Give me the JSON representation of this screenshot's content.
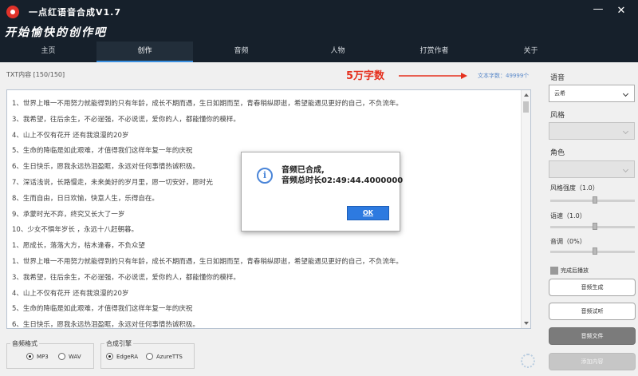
{
  "window": {
    "title": "一点红语音合成V1.7",
    "minimize": "—",
    "close": "✕"
  },
  "banner": {
    "slogan": "开始愉快的创作吧"
  },
  "tabs": [
    {
      "label": "主页"
    },
    {
      "label": "创作"
    },
    {
      "label": "音频"
    },
    {
      "label": "人物"
    },
    {
      "label": "打赏作者"
    },
    {
      "label": "关于"
    }
  ],
  "active_tab": "创作",
  "editor": {
    "header": "TXT内容 [150/150]",
    "annotation": "5万字数",
    "word_count": "文本字数：49999个",
    "lines": [
      "1、世界上唯一不用努力就能得到的只有年龄，成长不期而遇，生日如期而至，青春稍纵即逝，希望能遇见更好的自己，不负流年。",
      "3、我希望，往后余生，不必逞强，不必说谎，爱你的人，都能懂你的模样。",
      "4、山上不仅有花开 还有我浪漫的20岁",
      "5、生命的降临是如此艰难，才值得我们这样年复一年的庆祝",
      "6、生日快乐，愿我永远热泪盈眶，永远对任何事情热诚积极。",
      "7、深话浅说，长路慢走，未来美好的岁月里，愿一切安好，愿时光",
      "8、生而自由，日日欢愉，快意人生，乐得自在。",
      "9、承蒙时光不弃，终究又长大了一岁",
      "10、少女不惧年岁长 ，永远十八赶朝暮。",
      "1、愿成长，落落大方，枯木逢春，不负众望",
      "1、世界上唯一不用努力就能得到的只有年龄，成长不期而遇，生日如期而至，青春稍纵即逝，希望能遇见更好的自己，不负流年。",
      "3、我希望，往后余生，不必逞强，不必说谎，爱你的人，都能懂你的模样。",
      "4、山上不仅有花开 还有我浪漫的20岁",
      "5、生命的降临是如此艰难，才值得我们这样年复一年的庆祝",
      "6、生日快乐，愿我永远热泪盈眶，永远对任何事情热诚积极。"
    ]
  },
  "audio_format": {
    "title": "音频格式",
    "options": [
      "MP3",
      "WAV"
    ],
    "selected": "MP3"
  },
  "engine": {
    "title": "合成引擎",
    "options": [
      "EdgeRA",
      "AzureTTS"
    ],
    "selected": "EdgeRA"
  },
  "side_panel": {
    "voice_label": "语音",
    "voice_value": "云希",
    "style_label": "风格",
    "role_label": "角色",
    "style_strength_label": "风格强度（1.0）",
    "style_strength": 1.0,
    "speed_label": "语速（1.0）",
    "speed": 1.0,
    "pitch_label": "音调（0%）",
    "pitch_percent": 0,
    "autoplay_label": "完成后播放",
    "buttons": {
      "generate": "音频生成",
      "preview": "音频试听",
      "file": "音频文件",
      "add": "添加内容"
    }
  },
  "dialog": {
    "icon": "info-icon",
    "line1": "音频已合成,",
    "line2": "音频总时长02:49:44.4000000",
    "ok": "OK"
  },
  "colors": {
    "titlebar": "#16202b",
    "accent": "#3a8fe0",
    "annotation": "#e5301e",
    "ok_button": "#2d7ae0"
  }
}
